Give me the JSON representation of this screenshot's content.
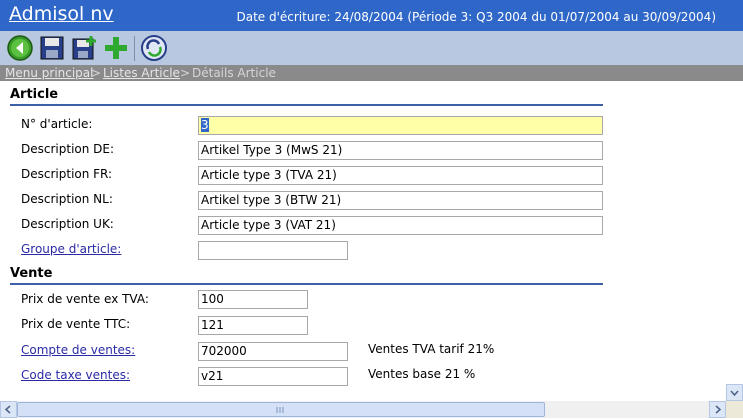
{
  "header": {
    "app_title": "Admisol nv",
    "date_info": "Date d'écriture: 24/08/2004 (Période 3: Q3 2004 du 01/07/2004 au 30/09/2004)"
  },
  "toolbar": {
    "icons": [
      "back-icon",
      "save-icon",
      "save-new-icon",
      "add-icon",
      "refresh-icon"
    ]
  },
  "breadcrumb": {
    "items": [
      "Menu principal",
      "Listes Article",
      "Détails Article"
    ],
    "separator": ">"
  },
  "article": {
    "section_title": "Article",
    "number_label": "N° d'article:",
    "number_value": "3",
    "desc_de_label": "Description DE:",
    "desc_de_value": "Artikel Type 3 (MwS 21)",
    "desc_fr_label": "Description FR:",
    "desc_fr_value": "Article type 3 (TVA 21)",
    "desc_nl_label": "Description NL:",
    "desc_nl_value": "Artikel type 3 (BTW 21)",
    "desc_uk_label": "Description UK:",
    "desc_uk_value": "Article type 3 (VAT 21)",
    "group_label": "Groupe d'article:",
    "group_value": ""
  },
  "vente": {
    "section_title": "Vente",
    "price_ex_label": "Prix de vente ex TVA:",
    "price_ex_value": "100",
    "price_ttc_label": "Prix de vente TTC:",
    "price_ttc_value": "121",
    "account_label": "Compte de ventes:",
    "account_value": "702000",
    "account_note": "Ventes TVA tarif 21%",
    "tax_label": "Code taxe ventes:",
    "tax_value": "v21",
    "tax_note": "Ventes base 21 %"
  },
  "colors": {
    "title_bar": "#2f67c9",
    "toolbar": "#b8c8e0",
    "breadcrumb": "#8a8a8a",
    "active_field": "#ffffa8",
    "link": "#2a2aa6"
  }
}
